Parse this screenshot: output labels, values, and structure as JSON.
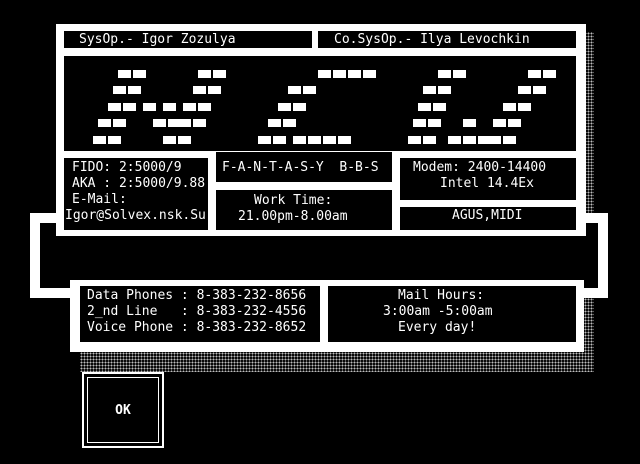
{
  "header": {
    "sysop": "SysOp.- Igor Zozulya",
    "cosysop": "Co.SysOp.- Ilya Levochkin"
  },
  "logo": {
    "semantic": "new-block-logo",
    "cells": [
      [
        118,
        70
      ],
      [
        133,
        70
      ],
      [
        198,
        70
      ],
      [
        213,
        70
      ],
      [
        318,
        70
      ],
      [
        333,
        70
      ],
      [
        348,
        70
      ],
      [
        363,
        70
      ],
      [
        438,
        70
      ],
      [
        453,
        70
      ],
      [
        528,
        70
      ],
      [
        543,
        70
      ],
      [
        113,
        86
      ],
      [
        128,
        86
      ],
      [
        193,
        86
      ],
      [
        208,
        86
      ],
      [
        288,
        86
      ],
      [
        303,
        86
      ],
      [
        423,
        86
      ],
      [
        438,
        86
      ],
      [
        518,
        86
      ],
      [
        533,
        86
      ],
      [
        108,
        103
      ],
      [
        123,
        103
      ],
      [
        143,
        103
      ],
      [
        163,
        103
      ],
      [
        183,
        103
      ],
      [
        198,
        103
      ],
      [
        278,
        103
      ],
      [
        293,
        103
      ],
      [
        418,
        103
      ],
      [
        433,
        103
      ],
      [
        503,
        103
      ],
      [
        518,
        103
      ],
      [
        98,
        119
      ],
      [
        113,
        119
      ],
      [
        153,
        119
      ],
      [
        168,
        119
      ],
      [
        178,
        119
      ],
      [
        193,
        119
      ],
      [
        268,
        119
      ],
      [
        283,
        119
      ],
      [
        413,
        119
      ],
      [
        428,
        119
      ],
      [
        463,
        119
      ],
      [
        493,
        119
      ],
      [
        508,
        119
      ],
      [
        93,
        136
      ],
      [
        108,
        136
      ],
      [
        163,
        136
      ],
      [
        178,
        136
      ],
      [
        258,
        136
      ],
      [
        273,
        136
      ],
      [
        293,
        136
      ],
      [
        308,
        136
      ],
      [
        323,
        136
      ],
      [
        338,
        136
      ],
      [
        408,
        136
      ],
      [
        423,
        136
      ],
      [
        448,
        136
      ],
      [
        463,
        136
      ],
      [
        478,
        136
      ],
      [
        488,
        136
      ],
      [
        503,
        136
      ]
    ]
  },
  "fido": {
    "line1": "FIDO: 2:5000/9",
    "line2": "AKA : 2:5000/9.88",
    "line3": "E-Mail:",
    "line4": "Igor@Solvex.nsk.Su"
  },
  "bbs_name": "F-A-N-T-A-S-Y  B-B-S",
  "modem": {
    "line1": "Modem: 2400-14400",
    "line2": "Intel 14.4Ex"
  },
  "work_time": {
    "title": "Work Time:",
    "value": "21.00pm-8.00am"
  },
  "protocols": "AGUS,MIDI",
  "phones": {
    "line1": "Data Phones : 8-383-232-8656",
    "line2": "2_nd Line   : 8-383-232-4556",
    "line3": "Voice Phone : 8-383-232-8652"
  },
  "mail_hours": {
    "title": "Mail Hours:",
    "time": "3:00am -5:00am",
    "days": "Every day!"
  },
  "ok_button": {
    "label": "OK"
  }
}
